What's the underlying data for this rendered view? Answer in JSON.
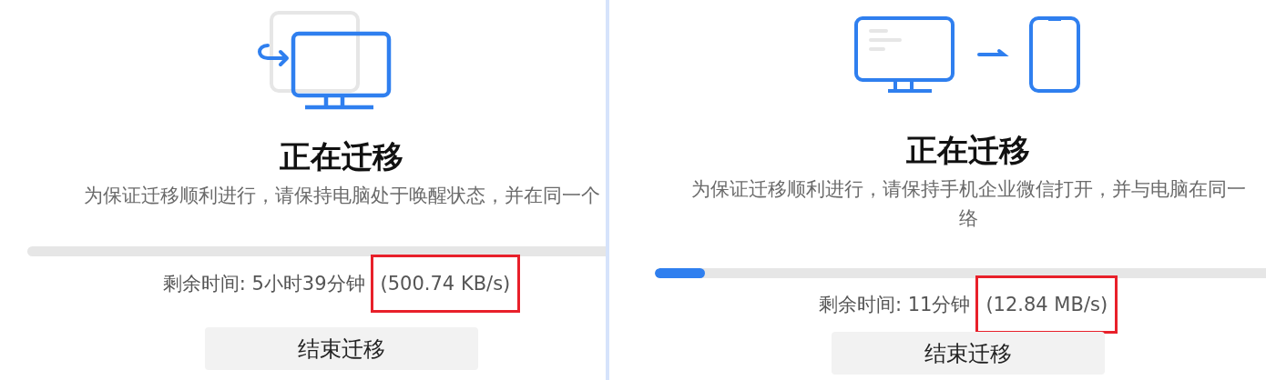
{
  "panels": [
    {
      "kind": "monitor-return",
      "title": "正在迁移",
      "description": [
        "为保证迁移顺利进行，请保持电脑处于唤醒状态，并在同一个"
      ],
      "remaining": "剩余时间: 5小时39分钟",
      "speed": {
        "text": "(500.74 KB/s)",
        "highlighted": true
      },
      "button": "结束迁移"
    },
    {
      "kind": "monitor-to-phone",
      "title": "正在迁移",
      "description": [
        "为保证迁移顺利进行，请保持手机企业微信打开，并与电脑在同一",
        "络"
      ],
      "progress": {
        "level": 0.08
      },
      "remaining": "剩余时间: 11分钟",
      "speed": {
        "text": "(12.84 MB/s)",
        "highlighted": true
      },
      "button": "结束迁移"
    }
  ]
}
